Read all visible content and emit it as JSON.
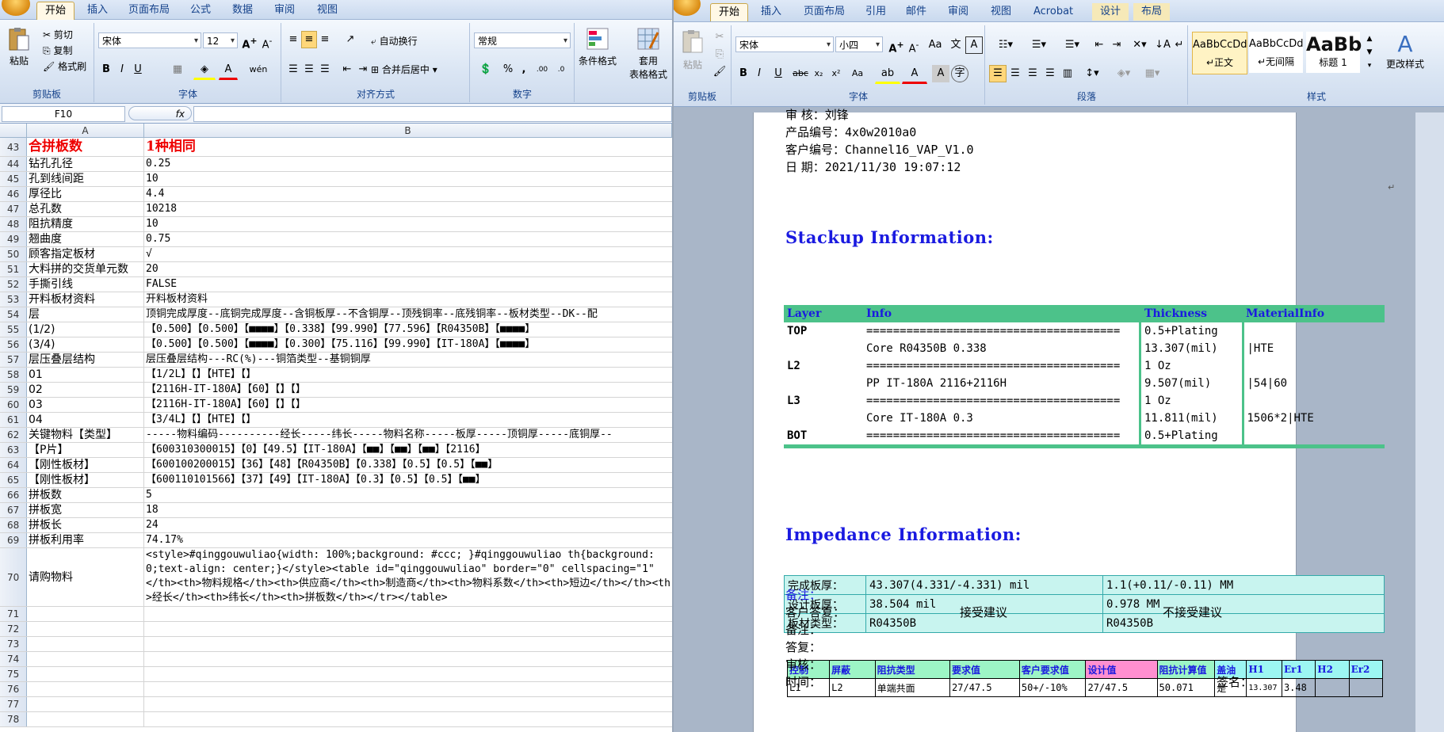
{
  "excel": {
    "tabs": [
      "开始",
      "插入",
      "页面布局",
      "公式",
      "数据",
      "审阅",
      "视图"
    ],
    "clipboard": {
      "paste": "粘贴",
      "cut": "剪切",
      "copy": "复制",
      "format_painter": "格式刷",
      "label": "剪贴板"
    },
    "font": {
      "name": "宋体",
      "size": "12",
      "label": "字体"
    },
    "align": {
      "wrap": "自动换行",
      "merge": "合并后居中",
      "label": "对齐方式"
    },
    "number": {
      "format": "常规",
      "label": "数字"
    },
    "styles": {
      "conditional": "条件格式",
      "table1": "套用",
      "table2": "表格格式"
    },
    "name_box": "F10",
    "fx": "fx",
    "columns": [
      "A",
      "B"
    ],
    "rows": [
      {
        "n": "43",
        "a": "合拼板数",
        "b": "1种相同",
        "big": true
      },
      {
        "n": "44",
        "a": "钻孔孔径",
        "b": "0.25"
      },
      {
        "n": "45",
        "a": "孔到线间距",
        "b": "10"
      },
      {
        "n": "46",
        "a": "厚径比",
        "b": "4.4"
      },
      {
        "n": "47",
        "a": "总孔数",
        "b": "10218"
      },
      {
        "n": "48",
        "a": "阻抗精度",
        "b": "10"
      },
      {
        "n": "49",
        "a": "翘曲度",
        "b": "0.75"
      },
      {
        "n": "50",
        "a": "顾客指定板材",
        "b": "√"
      },
      {
        "n": "51",
        "a": "大料拼的交货单元数",
        "b": "20"
      },
      {
        "n": "52",
        "a": "手撕引线",
        "b": "FALSE"
      },
      {
        "n": "53",
        "a": "开料板材资料",
        "b": "开料板材资料"
      },
      {
        "n": "54",
        "a": "层",
        "b": "顶铜完成厚度--底铜完成厚度--含铜板厚--不含铜厚--顶残铜率--底残铜率--板材类型--DK--配"
      },
      {
        "n": "55",
        "a": "(1/2)",
        "b": "【0.500】【0.500】【■■■■】【0.338】【99.990】【77.596】【R04350B】【■■■■】"
      },
      {
        "n": "56",
        "a": "(3/4)",
        "b": "【0.500】【0.500】【■■■■】【0.300】【75.116】【99.990】【IT-180A】【■■■■】"
      },
      {
        "n": "57",
        "a": "层压叠层结构",
        "b": "层压叠层结构---RC(%)---铜箔类型--基铜铜厚"
      },
      {
        "n": "58",
        "a": "01",
        "b": "【1/2L】【】【HTE】【】"
      },
      {
        "n": "59",
        "a": "02",
        "b": "【2116H-IT-180A】【60】【】【】"
      },
      {
        "n": "60",
        "a": "03",
        "b": "【2116H-IT-180A】【60】【】【】"
      },
      {
        "n": "61",
        "a": "04",
        "b": "【3/4L】【】【HTE】【】"
      },
      {
        "n": "62",
        "a": "关键物料【类型】",
        "b": "-----物料编码----------经长-----纬长-----物料名称-----板厚-----顶铜厚-----底铜厚--"
      },
      {
        "n": "63",
        "a": "【P片】",
        "b": "【600310300015】【0】【49.5】【IT-180A】【■■】【■■】【■■】【2116】"
      },
      {
        "n": "64",
        "a": "【刚性板材】",
        "b": "【600100200015】【36】【48】【R04350B】【0.338】【0.5】【0.5】【■■】"
      },
      {
        "n": "65",
        "a": "【刚性板材】",
        "b": "【600110101566】【37】【49】【IT-180A】【0.3】【0.5】【0.5】【■■】"
      },
      {
        "n": "66",
        "a": "拼板数",
        "b": "5"
      },
      {
        "n": "67",
        "a": "拼板宽",
        "b": "18"
      },
      {
        "n": "68",
        "a": "拼板长",
        "b": "24"
      },
      {
        "n": "69",
        "a": "拼板利用率",
        "b": "74.17%"
      },
      {
        "n": "70",
        "a": "请购物料",
        "b": "<style>#qinggouwuliao{width: 100%;background: #ccc; }#qinggouwuliao th{background: 0;text-align: center;}</style><table id=\"qinggouwuliao\" border=\"0\" cellspacing=\"1\" </th><th>物料规格</th><th>供应商</th><th>制造商</th><th>物料系数</th><th>短边</th></th><th>经长</th><th>纬长</th><th>拼板数</th></tr></table>",
        "tall": true
      },
      {
        "n": "71",
        "a": "",
        "b": ""
      },
      {
        "n": "72",
        "a": "",
        "b": ""
      },
      {
        "n": "73",
        "a": "",
        "b": ""
      },
      {
        "n": "74",
        "a": "",
        "b": ""
      },
      {
        "n": "75",
        "a": "",
        "b": ""
      },
      {
        "n": "76",
        "a": "",
        "b": ""
      },
      {
        "n": "77",
        "a": "",
        "b": ""
      },
      {
        "n": "78",
        "a": "",
        "b": ""
      }
    ]
  },
  "word": {
    "tabs": [
      "开始",
      "插入",
      "页面布局",
      "引用",
      "邮件",
      "审阅",
      "视图",
      "Acrobat",
      "设计",
      "布局"
    ],
    "clipboard": {
      "paste": "粘贴",
      "label": "剪贴板"
    },
    "font": {
      "name": "宋体",
      "size": "小四",
      "label": "字体"
    },
    "paragraph_label": "段落",
    "styles": {
      "s1_sample": "AaBbCcDd",
      "s1": "↵正文",
      "s2_sample": "AaBbCcDd",
      "s2": "↵无间隔",
      "s3_sample": "AaBb",
      "s3": "标题 1",
      "change": "更改样式",
      "label": "样式"
    },
    "header_lines": [
      {
        "label": "审    核：",
        "value": "刘锋"
      },
      {
        "label": "产品编号：",
        "value": "4x0w2010a0"
      },
      {
        "label": "客户编号：",
        "value": "Channel16_VAP_V1.0"
      },
      {
        "label": "日    期：",
        "value": "2021/11/30 19:07:12"
      }
    ],
    "stackup_title": "Stackup Information:",
    "stackup_head": [
      "Layer",
      "Info",
      "Thickness",
      "MaterialInfo"
    ],
    "stackup_rows": [
      [
        "TOP",
        "======================================",
        "0.5+Plating",
        ""
      ],
      [
        "",
        "Core    R04350B    0.338",
        "13.307(mil)",
        "|HTE"
      ],
      [
        "L2",
        "======================================",
        "1 Oz",
        ""
      ],
      [
        "",
        "PP    IT-180A    2116+2116H",
        "9.507(mil)",
        "|54|60"
      ],
      [
        "L3",
        "======================================",
        "1 Oz",
        ""
      ],
      [
        "",
        "Core    IT-180A    0.3",
        "11.811(mil)",
        "1506*2|HTE"
      ],
      [
        "BOT",
        "======================================",
        "0.5+Plating",
        ""
      ]
    ],
    "info_rows": [
      [
        "完成板厚：",
        "43.307(4.331/-4.331) mil",
        "1.1(+0.11/-0.11) MM"
      ],
      [
        "设计板厚：",
        "38.504 mil",
        "0.978 MM"
      ],
      [
        "板材类型：",
        "R04350B",
        "R04350B"
      ]
    ],
    "impedance_title": "Impedance Information:",
    "imp_head": [
      "控制",
      "屏蔽",
      "阻抗类型",
      "要求值",
      "客户要求值",
      "设计值",
      "阻抗计算值",
      "盖油",
      "H1",
      "Er1",
      "H2",
      "Er2"
    ],
    "imp_row": [
      "L1",
      "L2",
      "单端共面",
      "27/47.5",
      "50+/-10%",
      "27/47.5",
      "50.071",
      "是",
      "13.307",
      "3.48",
      "",
      ""
    ],
    "footer": {
      "remark": "备注：",
      "customer": "客户答复：",
      "accept": "接受建议",
      "reject": "不接受建议",
      "remark2": "备注：",
      "answer": "答复：",
      "review": "审核：",
      "time": "时间：",
      "sign": "签名："
    }
  }
}
